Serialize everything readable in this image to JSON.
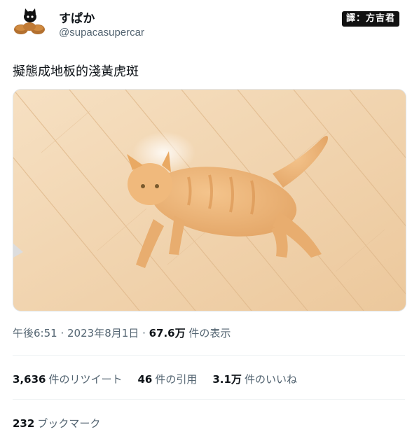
{
  "user": {
    "display_name": "すぱか",
    "handle": "@supacasupercar"
  },
  "watermark": "譯：方吉君",
  "tweet": {
    "text": "擬態成地板的淺黃虎斑",
    "media_alt": "orange tabby cat lying on light wooden floor"
  },
  "meta": {
    "time": "午後6:51",
    "date": "2023年8月1日",
    "views_count": "67.6万",
    "views_label": "件の表示"
  },
  "stats": {
    "retweets_count": "3,636",
    "retweets_label": "件のリツイート",
    "quotes_count": "46",
    "quotes_label": "件の引用",
    "likes_count": "3.1万",
    "likes_label": "件のいいね",
    "bookmarks_count": "232",
    "bookmarks_label": "ブックマーク"
  }
}
